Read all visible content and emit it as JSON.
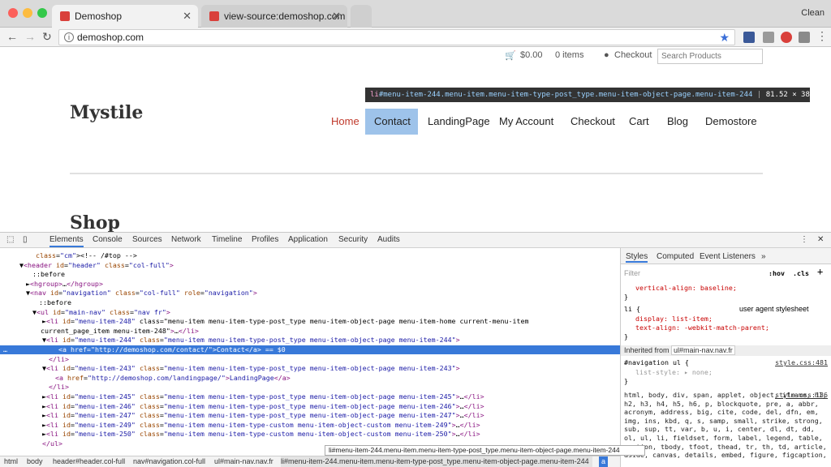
{
  "browser": {
    "tabs": [
      {
        "title": "Demoshop",
        "active": true
      },
      {
        "title": "view-source:demoshop.com",
        "active": false
      }
    ],
    "profile": "Clean",
    "url": "demoshop.com"
  },
  "site": {
    "cart_total": "$0.00",
    "cart_items": "0 items",
    "checkout": "Checkout",
    "search_placeholder": "Search Products",
    "logo": "Mystile",
    "nav": [
      "Home",
      "Contact",
      "LandingPage",
      "My Account",
      "Checkout",
      "Cart",
      "Blog",
      "Demostore"
    ],
    "page_title": "Shop",
    "tooltip": {
      "selector_tag": "li",
      "selector_rest": "#menu-item-244.menu-item.menu-item-type-post_type.menu-item-object-page.menu-item-244",
      "size": "81.52 × 38.81"
    }
  },
  "devtools": {
    "tabs": [
      "Elements",
      "Console",
      "Sources",
      "Network",
      "Timeline",
      "Profiles",
      "Application",
      "Security",
      "Audits"
    ],
    "dom_lines": [
      "<!-- /#top -->",
      "▼<header id=\"header\" class=\"col-full\">",
      "::before",
      "►<hgroup>…</hgroup>",
      "▼<nav id=\"navigation\" class=\"col-full\" role=\"navigation\">",
      "::before",
      "▼<ul id=\"main-nav\" class=\"nav fr\">",
      "►<li id=\"menu-item-248\" class=\"menu-item menu-item-type-post_type menu-item-object-page menu-item-home current-menu-item",
      "current_page_item menu-item-248\">…</li>",
      "▼<li id=\"menu-item-244\" class=\"menu-item menu-item-type-post_type menu-item-object-page menu-item-244\">",
      "<a href=\"http://demoshop.com/contact/\">Contact</a> == $0",
      "</li>",
      "▼<li id=\"menu-item-243\" class=\"menu-item menu-item-type-post_type menu-item-object-page menu-item-243\">",
      "<a href=\"http://demoshop.com/landingpage/\">LandingPage</a>",
      "</li>",
      "►<li id=\"menu-item-245\" class=\"menu-item menu-item-type-post_type menu-item-object-page menu-item-245\">…</li>",
      "►<li id=\"menu-item-246\" class=\"menu-item menu-item-type-post_type menu-item-object-page menu-item-246\">…</li>",
      "►<li id=\"menu-item-247\" class=\"menu-item menu-item-type-post_type menu-item-object-page menu-item-247\">…</li>",
      "►<li id=\"menu-item-249\" class=\"menu-item menu-item-type-custom menu-item-object-custom menu-item-249\">…</li>",
      "►<li id=\"menu-item-250\" class=\"menu-item menu-item-type-custom menu-item-object-custom menu-item-250\">…</li>",
      "</ul>"
    ],
    "styles": {
      "tabs": [
        "Styles",
        "Computed",
        "Event Listeners"
      ],
      "filter": "Filter",
      "hov": ":hov",
      "cls": ".cls",
      "rule1_prop": "vertical-align: baseline;",
      "rule2_selector": "li {",
      "rule2_source": "user agent stylesheet",
      "rule2_p1": "display: list-item;",
      "rule2_p2": "text-align: -webkit-match-parent;",
      "inherited": "Inherited from",
      "inherited_sel": "ul#main-nav.nav.fr",
      "rule3_selector": "#navigation ul {",
      "rule3_source": "style.css:481",
      "rule3_p1": "list-style: ▸ none;",
      "rule4_source": "style.css:136",
      "rule4_text": "html, body, div, span, applet, object, iframe, h1, h2, h3, h4, h5, h6, p, blockquote, pre, a, abbr, acronym, address, big, cite, code, del, dfn, em, img, ins, kbd, q, s, samp, small, strike, strong, sub, sup, tt, var, b, u, i, center, dl, dt, dd, ol, ul, li, fieldset, form, label, legend, table, caption, tbody, tfoot, thead, tr, th, td, article, aside, canvas, details, embed, figure, figcaption,"
    },
    "breadcrumbs": [
      "html",
      "body",
      "header#header.col-full",
      "nav#navigation.col-full",
      "ul#main-nav.nav.fr",
      "li#menu-item-244.menu-item.menu-item-type-post_type.menu-item-object-page.menu-item-244",
      "a"
    ],
    "breadcrumb_tip": "li#menu-item-244.menu-item.menu-item-type-post_type.menu-item-object-page.menu-item-244"
  }
}
